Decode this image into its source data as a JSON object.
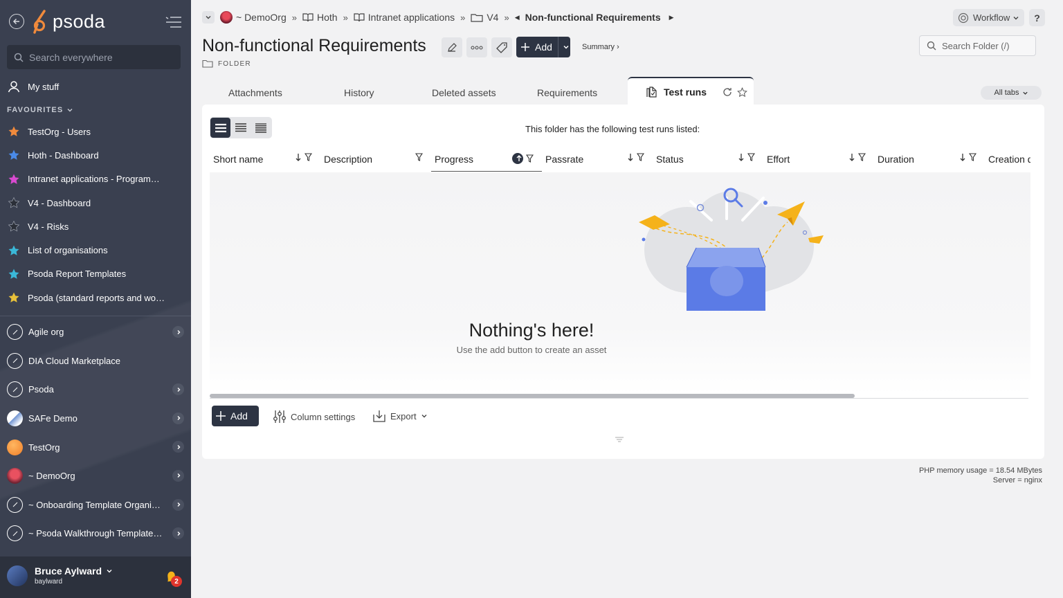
{
  "sidebar": {
    "logo_text": "psoda",
    "search_placeholder": "Search everywhere",
    "my_stuff": "My stuff",
    "favourites_header": "FAVOURITES",
    "favourites": [
      {
        "label": "TestOrg - Users",
        "color": "#f08a3c"
      },
      {
        "label": "Hoth - Dashboard",
        "color": "#4a8ae8"
      },
      {
        "label": "Intranet applications - Programme...",
        "color": "#d84ad0"
      },
      {
        "label": "V4 - Dashboard",
        "color": "#2b2f38"
      },
      {
        "label": "V4 - Risks",
        "color": "#2b2f38"
      },
      {
        "label": "List of organisations",
        "color": "#3ab8d8"
      },
      {
        "label": "Psoda Report Templates",
        "color": "#3ab8d8"
      },
      {
        "label": "Psoda (standard reports and work...",
        "color": "#e8c13a"
      }
    ],
    "organisations": [
      {
        "label": "Agile org",
        "icon": "compass-icon",
        "has_chevron": true
      },
      {
        "label": "DIA Cloud Marketplace",
        "icon": "compass-icon",
        "has_chevron": false
      },
      {
        "label": "Psoda",
        "icon": "compass-icon",
        "has_chevron": true
      },
      {
        "label": "SAFe Demo",
        "icon": "safe-logo-icon",
        "has_chevron": true
      },
      {
        "label": "TestOrg",
        "icon": "orange-circle-icon",
        "has_chevron": true
      },
      {
        "label": "~ DemoOrg",
        "icon": "demo-org-icon",
        "has_chevron": true
      },
      {
        "label": "~ Onboarding Template Organisa...",
        "icon": "compass-icon",
        "has_chevron": true
      },
      {
        "label": "~ Psoda Walkthrough Template P...",
        "icon": "compass-icon",
        "has_chevron": true
      }
    ],
    "user": {
      "name": "Bruce Aylward",
      "login": "baylward",
      "notifications": "2"
    }
  },
  "breadcrumb": {
    "items": [
      {
        "label": "~ DemoOrg",
        "icon": "demo-org-icon"
      },
      {
        "label": "Hoth",
        "icon": "book-icon"
      },
      {
        "label": "Intranet applications",
        "icon": "book-icon"
      },
      {
        "label": "V4",
        "icon": "folder-icon"
      }
    ],
    "current": "Non-functional Requirements"
  },
  "header": {
    "title": "Non-functional Requirements",
    "type_label": "FOLDER",
    "add_label": "Add",
    "summary_label": "Summary ›",
    "workflow_label": "Workflow",
    "help_label": "?",
    "search_placeholder": "Search Folder (/)"
  },
  "tabs": {
    "items": [
      "Attachments",
      "History",
      "Deleted assets",
      "Requirements"
    ],
    "active": "Test runs",
    "all_tabs": "All tabs"
  },
  "panel": {
    "intro": "This folder has the following test runs listed:",
    "columns": [
      "Short name",
      "Description",
      "Progress",
      "Passrate",
      "Status",
      "Effort",
      "Duration",
      "Creation d"
    ],
    "sorted_column": "Progress",
    "empty_title": "Nothing's here!",
    "empty_subtitle": "Use the add button to create an asset",
    "add_label": "Add",
    "column_settings_label": "Column settings",
    "export_label": "Export"
  },
  "footer": {
    "memory": "PHP memory usage = 18.54 MBytes",
    "server": "Server = nginx"
  },
  "colors": {
    "sidebar_bg": "#3a4050",
    "dark_button": "#2d3443",
    "accent_blue": "#5b7be6",
    "accent_orange": "#f5a623"
  }
}
